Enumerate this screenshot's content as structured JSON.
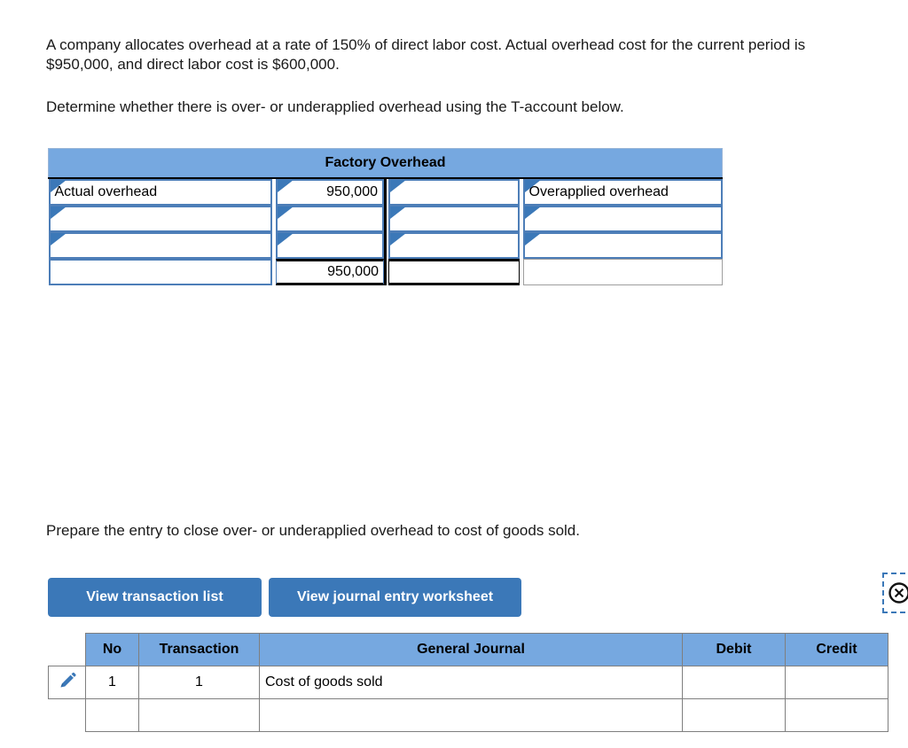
{
  "prompts": {
    "intro": "A company allocates overhead at a rate of 150% of direct labor cost. Actual overhead cost for the current period is $950,000, and direct labor cost is $600,000.",
    "determine": "Determine whether there is over- or underapplied overhead using the T-account below.",
    "prepare": "Prepare the entry to close over- or underapplied overhead to cost of goods sold."
  },
  "t_account": {
    "title": "Factory Overhead",
    "rows": [
      {
        "debit_label": "Actual overhead",
        "debit_amount": "950,000",
        "credit_amount": "",
        "credit_label": "Overapplied overhead"
      },
      {
        "debit_label": "",
        "debit_amount": "",
        "credit_amount": "",
        "credit_label": ""
      },
      {
        "debit_label": "",
        "debit_amount": "",
        "credit_amount": "",
        "credit_label": ""
      }
    ],
    "total_row": {
      "debit_label": "",
      "debit_amount": "950,000",
      "credit_amount": "",
      "credit_label": ""
    }
  },
  "buttons": {
    "transaction_list": "View transaction list",
    "journal_worksheet": "View journal entry worksheet"
  },
  "icons": {
    "close": "close-circle-icon",
    "edit": "pencil-icon",
    "cell_marker": "blue-triangle-marker-icon"
  },
  "journal": {
    "headers": {
      "no": "No",
      "transaction": "Transaction",
      "general_journal": "General Journal",
      "debit": "Debit",
      "credit": "Credit"
    },
    "rows": [
      {
        "no": "1",
        "transaction": "1",
        "general_journal": "Cost of goods sold",
        "debit": "",
        "credit": ""
      },
      {
        "no": "",
        "transaction": "",
        "general_journal": "",
        "debit": "",
        "credit": ""
      }
    ]
  },
  "colors": {
    "header_blue": "#76a8e0",
    "button_blue": "#3b78b8",
    "cell_border_blue": "#4d7eb8",
    "grid_grey": "#7f7f7f"
  }
}
